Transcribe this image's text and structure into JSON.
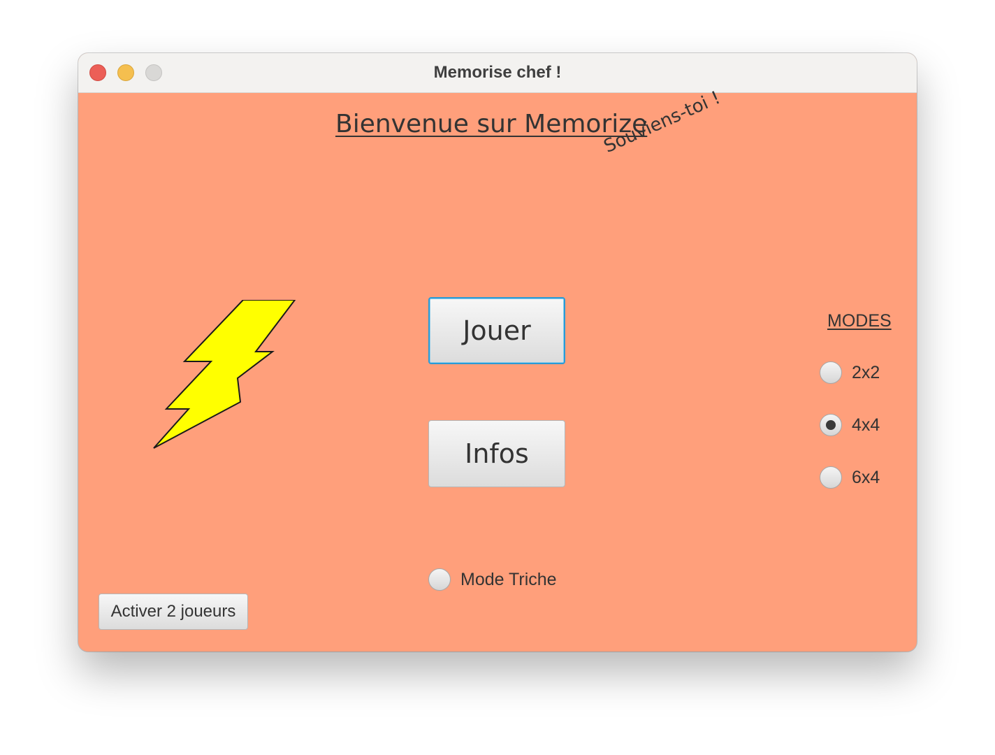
{
  "window": {
    "title": "Memorise chef !"
  },
  "main": {
    "welcome": "Bienvenue sur Memorize",
    "tagline": "Souviens-toi !",
    "play_label": "Jouer",
    "infos_label": "Infos",
    "cheat_label": "Mode Triche",
    "two_players_label": "Activer 2 joueurs"
  },
  "modes": {
    "title": "MODES",
    "options": [
      {
        "label": "2x2",
        "selected": false
      },
      {
        "label": "4x4",
        "selected": true
      },
      {
        "label": "6x4",
        "selected": false
      }
    ]
  },
  "colors": {
    "background": "#ff9f7b",
    "bolt_fill": "#ffff00",
    "focus": "#2a9bd6"
  }
}
